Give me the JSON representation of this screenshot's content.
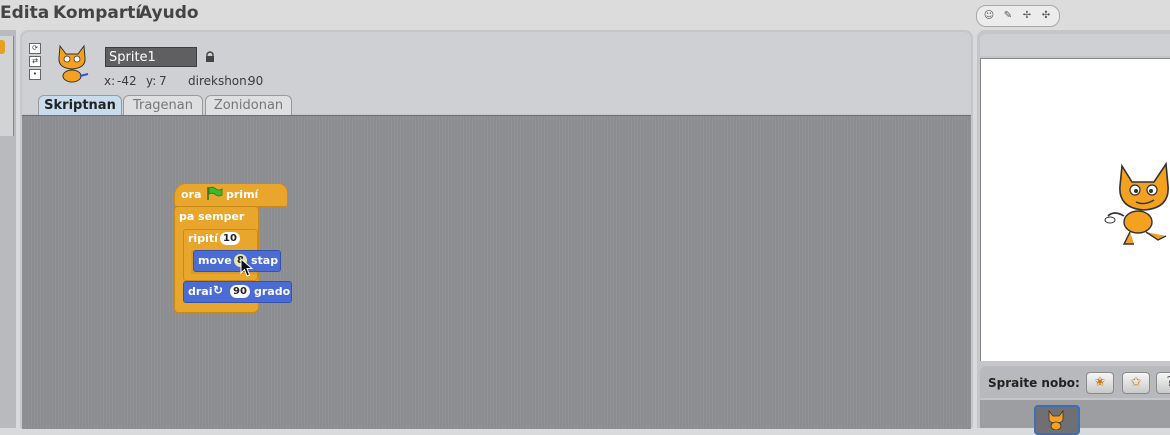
{
  "menu": {
    "items": [
      "Edita",
      "Kompartí",
      "Ayudo"
    ]
  },
  "topicons": [
    "person-icon",
    "wrench-icon",
    "expand-icon",
    "shrink-icon"
  ],
  "sprite": {
    "name": "Sprite1",
    "x_label": "x:",
    "x_value": "-42",
    "y_label": "y:",
    "y_value": "7",
    "direction_label": "direkshon:",
    "direction_value": "90"
  },
  "tabs": [
    {
      "label": "Skriptnan",
      "active": true
    },
    {
      "label": "Tragenan",
      "active": false
    },
    {
      "label": "Zonidonan",
      "active": false
    }
  ],
  "script": {
    "hat_before": "ora",
    "hat_after": "primí",
    "forever": "pa semper",
    "repeat_label": "ripití",
    "repeat_value": "10",
    "move_label": "move",
    "move_value": "8",
    "move_unit": "stap",
    "turn_label": "drai",
    "turn_value": "90",
    "turn_unit": "grado"
  },
  "stage_panel": {
    "new_sprite_label": "Spraite nobo:",
    "third_button": "?"
  },
  "colors": {
    "control": "#e8a62c",
    "motion": "#4a6cd4",
    "active_tab": "#c8dced"
  }
}
